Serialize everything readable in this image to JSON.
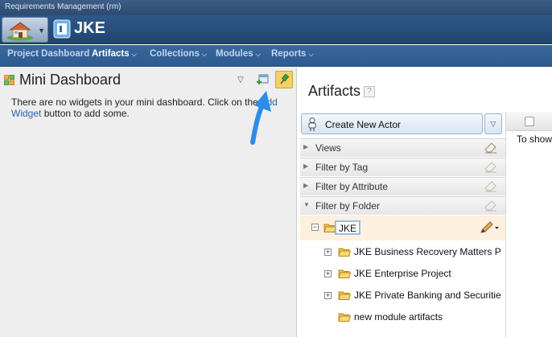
{
  "app": {
    "title": "Requirements Management (rm)",
    "project": "JKE"
  },
  "nav": {
    "items": [
      {
        "label": "Project Dashboard",
        "dropdown": false
      },
      {
        "label": "Artifacts",
        "dropdown": true,
        "active": true
      },
      {
        "label": "Collections",
        "dropdown": true
      },
      {
        "label": "Modules",
        "dropdown": true
      },
      {
        "label": "Reports",
        "dropdown": true
      }
    ],
    "caret": "⌵"
  },
  "mini_dashboard": {
    "title": "Mini Dashboard",
    "message_pre": "There are no widgets in your mini dashboard. Click on the ",
    "message_link": "Add Widget",
    "message_post": " button to add some."
  },
  "artifacts": {
    "title": "Artifacts",
    "help": "?",
    "create_button": "Create New Actor",
    "sections": [
      "Views",
      "Filter by Tag",
      "Filter by Attribute",
      "Filter by Folder"
    ],
    "tree": {
      "root": "JKE",
      "children": [
        {
          "label": "JKE Business Recovery Matters P",
          "expandable": true
        },
        {
          "label": "JKE Enterprise Project",
          "expandable": true
        },
        {
          "label": "JKE Private Banking and Securitie",
          "expandable": true
        },
        {
          "label": "new module artifacts",
          "expandable": false
        }
      ]
    },
    "grid_hint": "To show"
  },
  "colors": {
    "nav_bg": "#2d5a8f",
    "accent_link": "#2a63ad",
    "highlight_row": "#fdf0de",
    "arrow": "#2d8ce6"
  }
}
